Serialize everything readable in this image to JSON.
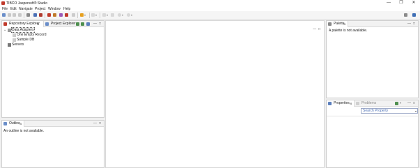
{
  "window": {
    "title": "TIBCO Jaspersoft® Studio",
    "controls": [
      "—",
      "❐",
      "✕"
    ]
  },
  "menu": [
    "File",
    "Edit",
    "Navigate",
    "Project",
    "Window",
    "Help"
  ],
  "left_top_view": {
    "tabs": [
      {
        "label": "Repository Explorer",
        "close": "⊠"
      },
      {
        "label": "Project Explorer"
      }
    ],
    "tree": {
      "data_adapters": "Data Adapters",
      "one_empty_record": "One Empty Record",
      "sample_db": "Sample DB",
      "servers": "Servers",
      "expander": "⌄"
    },
    "min": "—",
    "max": "□"
  },
  "outline_view": {
    "tab_label": "Outline",
    "close": "⊠",
    "message": "An outline is not available.",
    "min": "—",
    "max": "□"
  },
  "editor": {
    "min": "—",
    "max": "□"
  },
  "palette_view": {
    "tab_label": "Palette",
    "close": "⊠",
    "message": "A palette is not available.",
    "min": "—",
    "max": "□"
  },
  "properties_view": {
    "tabs": [
      {
        "label": "Properties",
        "close": "⊠"
      },
      {
        "label": "Problems"
      }
    ],
    "search_placeholder": "Search Property",
    "dropdown": "▾",
    "min": "—",
    "max": "□"
  },
  "colors": {
    "accent_red": "#c0392b",
    "link_blue": "#4a6fb5"
  }
}
